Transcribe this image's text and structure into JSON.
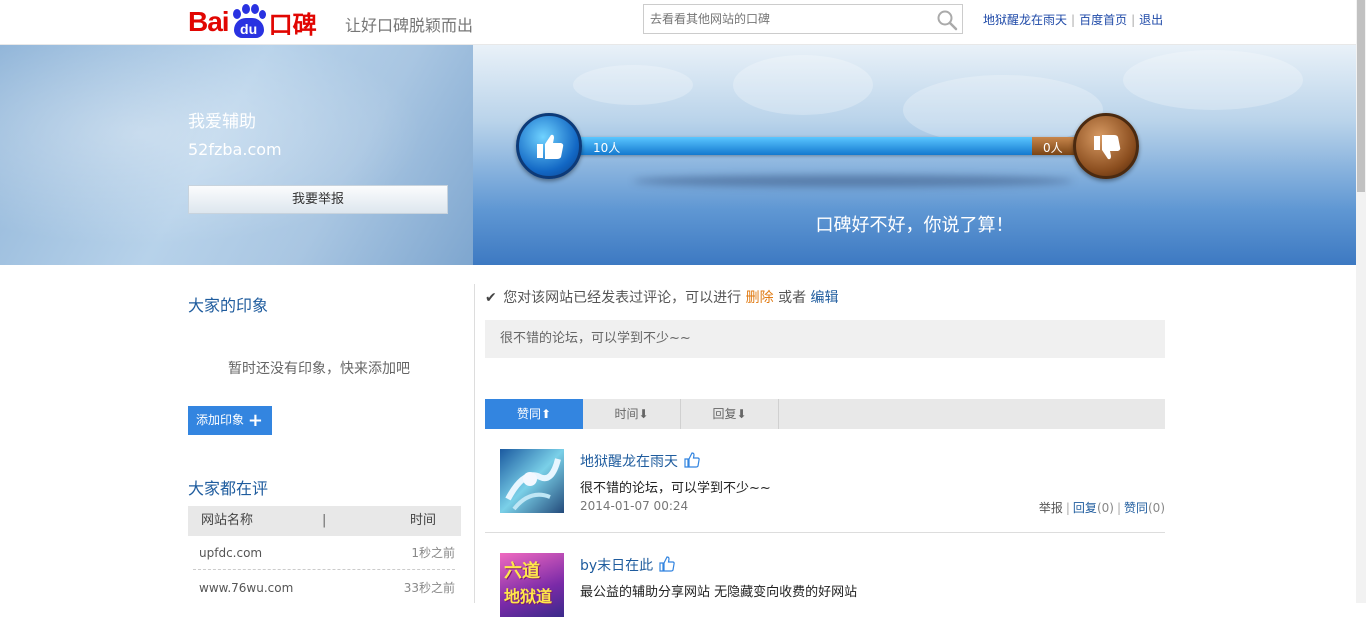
{
  "header": {
    "logo_bai": "Bai",
    "logo_du": "du",
    "logo_koubei": "口碑",
    "slogan": "让好口碑脱颖而出",
    "search_placeholder": "去看看其他网站的口碑",
    "links": {
      "user": "地狱醒龙在雨天",
      "home": "百度首页",
      "logout": "退出"
    }
  },
  "banner": {
    "site_name": "我爱辅助",
    "site_url": "52fzba.com",
    "report_label": "我要举报",
    "up_count_label": "10人",
    "down_count_label": "0人",
    "up_fraction": 0.85,
    "slogan": "口碑好不好，你说了算！"
  },
  "impressions": {
    "title": "大家的印象",
    "empty_tip": "暂时还没有印象，快来添加吧",
    "add_label": "添加印象",
    "add_symbol": "+"
  },
  "ranking": {
    "title": "大家都在评",
    "col_name": "网站名称",
    "col_sep": "|",
    "col_time": "时间",
    "rows": [
      {
        "name": "upfdc.com",
        "time": "1秒之前"
      },
      {
        "name": "www.76wu.com",
        "time": "33秒之前"
      }
    ]
  },
  "notice": {
    "check": "✔",
    "prefix": "您对该网站已经发表过评论，可以进行",
    "delete": "删除",
    "or": "或者",
    "edit": "编辑"
  },
  "my_comment": "很不错的论坛，可以学到不少~~",
  "tabs": [
    {
      "label": "赞同",
      "arrow": "⬆"
    },
    {
      "label": "时间",
      "arrow": "⬇"
    },
    {
      "label": "回复",
      "arrow": "⬇"
    }
  ],
  "reviews": [
    {
      "user": "地狱醒龙在雨天",
      "text": "很不错的论坛，可以学到不少~~",
      "date": "2014-01-07 00:24",
      "report": "举报",
      "reply": "回复",
      "reply_count": "(0)",
      "agree": "赞同",
      "agree_count": "(0)"
    },
    {
      "user": "by末日在此",
      "text": "最公益的辅助分享网站 无隐藏变向收费的好网站",
      "avatar_text": "六道",
      "avatar_text2": "地狱道"
    }
  ],
  "colors": {
    "accent": "#3385e0",
    "link": "#1f5c9e",
    "brand_red": "#e10602",
    "brand_blue": "#2932e1",
    "delete": "#e07a12"
  }
}
